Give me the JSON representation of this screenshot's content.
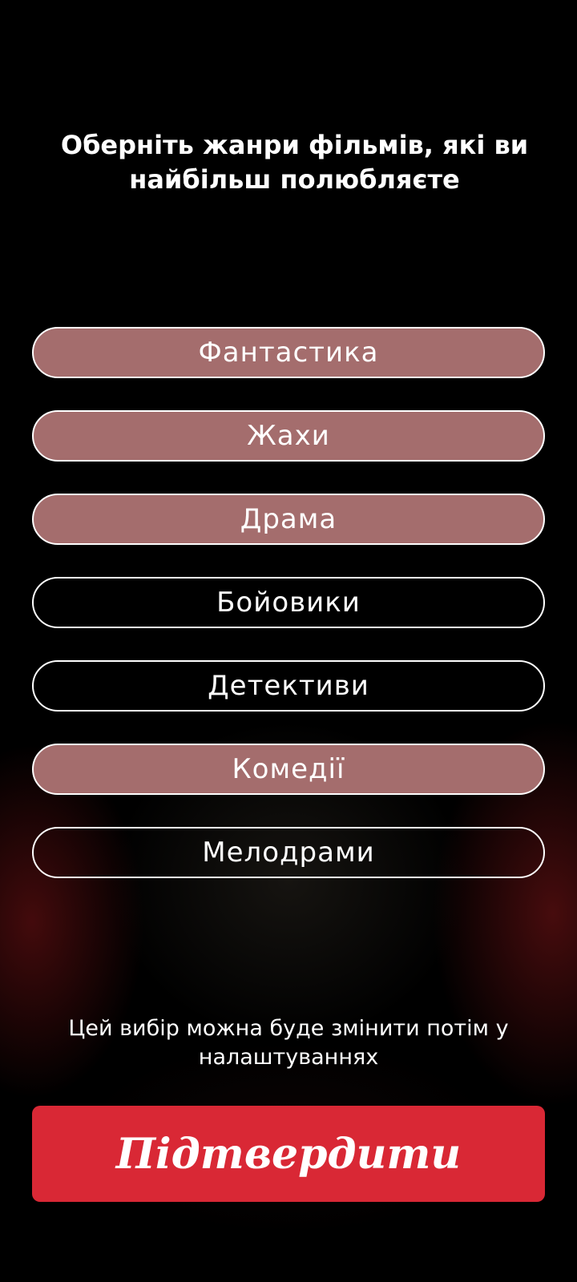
{
  "screen": {
    "title": "Оберніть жанри фільмів, які ви найбільш полюбляєте",
    "genres": [
      {
        "label": "Фантастика",
        "selected": true
      },
      {
        "label": "Жахи",
        "selected": true
      },
      {
        "label": "Драма",
        "selected": true
      },
      {
        "label": "Бойовики",
        "selected": false
      },
      {
        "label": "Детективи",
        "selected": false
      },
      {
        "label": "Комедії",
        "selected": true
      },
      {
        "label": "Мелодрами",
        "selected": false
      }
    ],
    "hint": "Цей вибір можна буде змінити потім у налаштуваннях",
    "confirm_label": "Підтвердити"
  },
  "colors": {
    "background": "#000000",
    "selected_fill": "#a46d6d",
    "confirm_button": "#d92835",
    "text": "#ffffff"
  }
}
